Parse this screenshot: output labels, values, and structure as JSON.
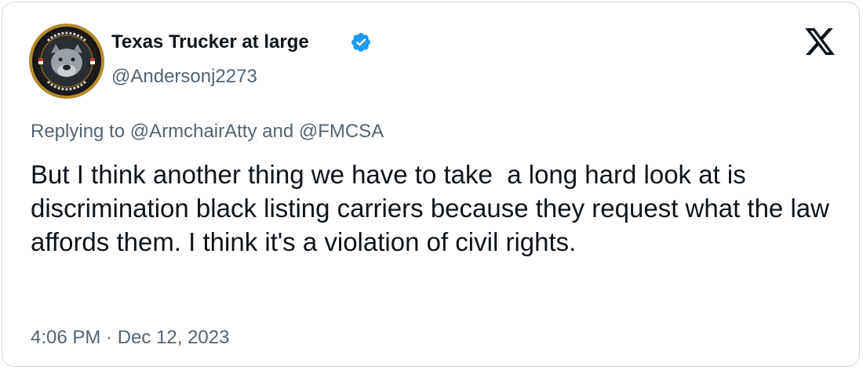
{
  "tweet": {
    "author": {
      "display_name": "Texas Trucker at large",
      "handle": "@Andersonj2273",
      "verified": true,
      "avatar_icon": "pitbull-badge-avatar",
      "avatar_ring_color": "#b48a2c",
      "verified_badge_color": "#1d9bf0"
    },
    "brand_logo": "x-logo",
    "reply_to": "Replying to @ArmchairAtty and @FMCSA",
    "text": "But I think another thing we have to take  a long hard look at is discrimination black listing carriers because they request what the law affords them. I think it's a violation of civil rights.",
    "timestamp": "4:06 PM · Dec 12, 2023"
  }
}
